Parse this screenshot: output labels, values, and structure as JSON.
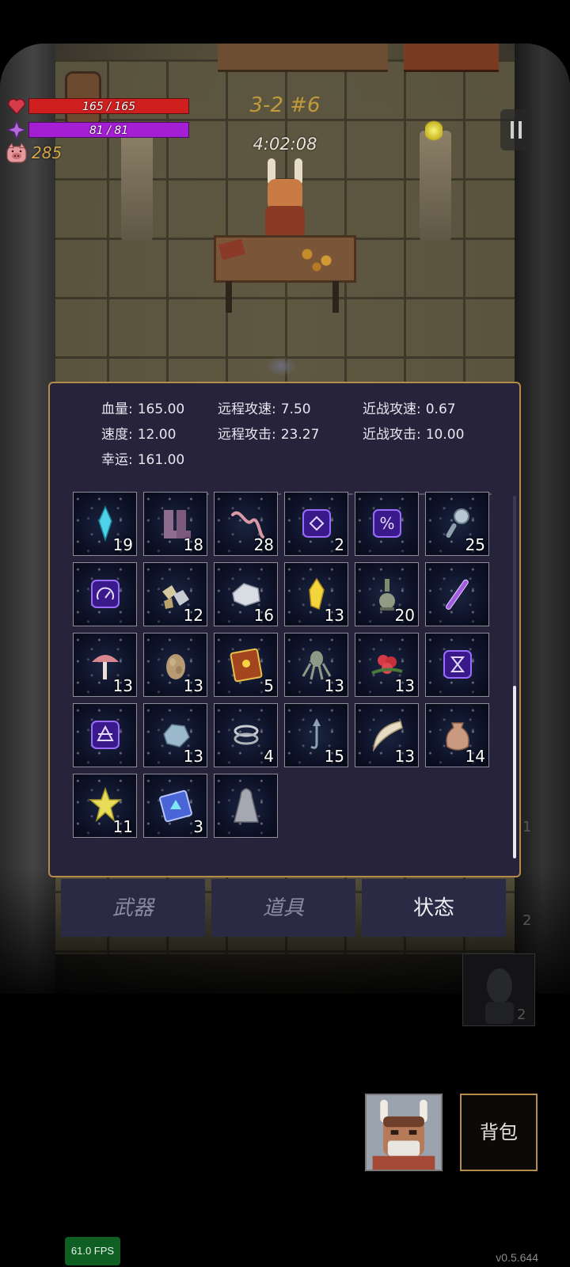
{
  "hud": {
    "hp_text": "165 / 165",
    "hp_fraction": 1.0,
    "mp_text": "81 / 81",
    "mp_fraction": 1.0,
    "coins": "285",
    "level": "3-2 #6",
    "timer": "4:02:08"
  },
  "stats": {
    "hp_label": "血量:",
    "hp_value": "165.00",
    "speed_label": "速度:",
    "speed_value": "12.00",
    "luck_label": "幸运:",
    "luck_value": "161.00",
    "ranged_speed_label": "远程攻速:",
    "ranged_speed_value": "7.50",
    "ranged_attack_label": "远程攻击:",
    "ranged_attack_value": "23.27",
    "melee_speed_label": "近战攻速:",
    "melee_speed_value": "0.67",
    "melee_attack_label": "近战攻击:",
    "melee_attack_value": "10.00"
  },
  "items": [
    {
      "icon": "blue-crystal-icon",
      "count": "19"
    },
    {
      "icon": "boots-icon",
      "count": "18"
    },
    {
      "icon": "worm-icon",
      "count": "28"
    },
    {
      "icon": "rune-diamond-icon",
      "count": "2"
    },
    {
      "icon": "rune-percent-icon",
      "count": ""
    },
    {
      "icon": "magnifier-icon",
      "count": "25"
    },
    {
      "icon": "rune-gauge-icon",
      "count": ""
    },
    {
      "icon": "ore-chunks-icon",
      "count": "12"
    },
    {
      "icon": "silver-ore-icon",
      "count": "16"
    },
    {
      "icon": "gold-crystal-icon",
      "count": "13"
    },
    {
      "icon": "potion-flask-icon",
      "count": "20"
    },
    {
      "icon": "purple-wand-icon",
      "count": ""
    },
    {
      "icon": "mushroom-icon",
      "count": "13"
    },
    {
      "icon": "egg-sack-icon",
      "count": "13"
    },
    {
      "icon": "spell-book-icon",
      "count": "5"
    },
    {
      "icon": "octopus-icon",
      "count": "13"
    },
    {
      "icon": "red-flower-icon",
      "count": "13"
    },
    {
      "icon": "rune-hourglass-icon",
      "count": ""
    },
    {
      "icon": "rune-triangle-icon",
      "count": ""
    },
    {
      "icon": "blue-stone-icon",
      "count": "13"
    },
    {
      "icon": "silver-rings-icon",
      "count": "4"
    },
    {
      "icon": "hook-icon",
      "count": "15"
    },
    {
      "icon": "fang-icon",
      "count": "13"
    },
    {
      "icon": "pouch-icon",
      "count": "14"
    },
    {
      "icon": "star-crystal-icon",
      "count": "11"
    },
    {
      "icon": "blue-tome-icon",
      "count": "3"
    },
    {
      "icon": "cloak-icon",
      "count": ""
    }
  ],
  "tabs": {
    "weapons": "武器",
    "items": "道具",
    "status": "状态"
  },
  "side": {
    "count1": "1",
    "count2": "2",
    "count3": "2"
  },
  "bag_label": "背包",
  "fps": "61.0 FPS",
  "version": "v0.5.644",
  "colors": {
    "hp": "#cf1f1f",
    "mp": "#a41ed3",
    "panel_bg": "#26233b",
    "panel_border": "#b58b4a",
    "coin_text": "#d6a84a",
    "level_text": "#c19a3c"
  }
}
